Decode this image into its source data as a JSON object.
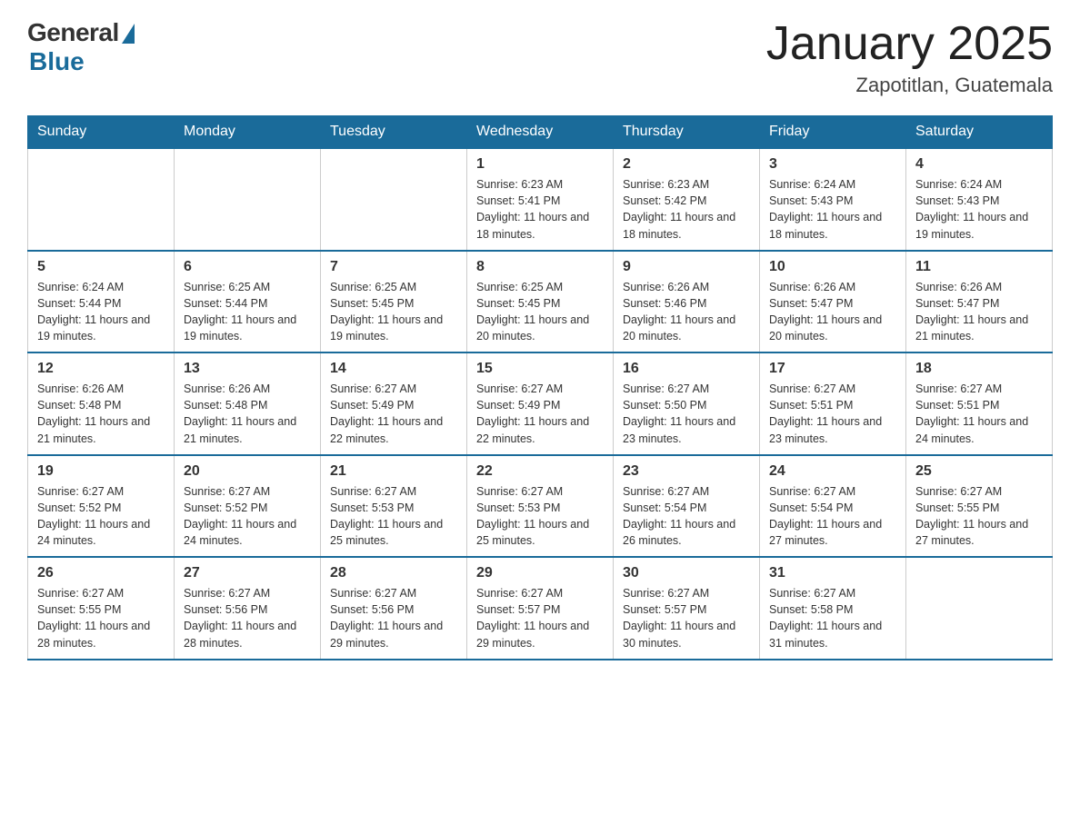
{
  "header": {
    "logo_general": "General",
    "logo_blue": "Blue",
    "month_title": "January 2025",
    "location": "Zapotitlan, Guatemala"
  },
  "weekdays": [
    "Sunday",
    "Monday",
    "Tuesday",
    "Wednesday",
    "Thursday",
    "Friday",
    "Saturday"
  ],
  "weeks": [
    [
      {
        "day": "",
        "info": ""
      },
      {
        "day": "",
        "info": ""
      },
      {
        "day": "",
        "info": ""
      },
      {
        "day": "1",
        "info": "Sunrise: 6:23 AM\nSunset: 5:41 PM\nDaylight: 11 hours\nand 18 minutes."
      },
      {
        "day": "2",
        "info": "Sunrise: 6:23 AM\nSunset: 5:42 PM\nDaylight: 11 hours\nand 18 minutes."
      },
      {
        "day": "3",
        "info": "Sunrise: 6:24 AM\nSunset: 5:43 PM\nDaylight: 11 hours\nand 18 minutes."
      },
      {
        "day": "4",
        "info": "Sunrise: 6:24 AM\nSunset: 5:43 PM\nDaylight: 11 hours\nand 19 minutes."
      }
    ],
    [
      {
        "day": "5",
        "info": "Sunrise: 6:24 AM\nSunset: 5:44 PM\nDaylight: 11 hours\nand 19 minutes."
      },
      {
        "day": "6",
        "info": "Sunrise: 6:25 AM\nSunset: 5:44 PM\nDaylight: 11 hours\nand 19 minutes."
      },
      {
        "day": "7",
        "info": "Sunrise: 6:25 AM\nSunset: 5:45 PM\nDaylight: 11 hours\nand 19 minutes."
      },
      {
        "day": "8",
        "info": "Sunrise: 6:25 AM\nSunset: 5:45 PM\nDaylight: 11 hours\nand 20 minutes."
      },
      {
        "day": "9",
        "info": "Sunrise: 6:26 AM\nSunset: 5:46 PM\nDaylight: 11 hours\nand 20 minutes."
      },
      {
        "day": "10",
        "info": "Sunrise: 6:26 AM\nSunset: 5:47 PM\nDaylight: 11 hours\nand 20 minutes."
      },
      {
        "day": "11",
        "info": "Sunrise: 6:26 AM\nSunset: 5:47 PM\nDaylight: 11 hours\nand 21 minutes."
      }
    ],
    [
      {
        "day": "12",
        "info": "Sunrise: 6:26 AM\nSunset: 5:48 PM\nDaylight: 11 hours\nand 21 minutes."
      },
      {
        "day": "13",
        "info": "Sunrise: 6:26 AM\nSunset: 5:48 PM\nDaylight: 11 hours\nand 21 minutes."
      },
      {
        "day": "14",
        "info": "Sunrise: 6:27 AM\nSunset: 5:49 PM\nDaylight: 11 hours\nand 22 minutes."
      },
      {
        "day": "15",
        "info": "Sunrise: 6:27 AM\nSunset: 5:49 PM\nDaylight: 11 hours\nand 22 minutes."
      },
      {
        "day": "16",
        "info": "Sunrise: 6:27 AM\nSunset: 5:50 PM\nDaylight: 11 hours\nand 23 minutes."
      },
      {
        "day": "17",
        "info": "Sunrise: 6:27 AM\nSunset: 5:51 PM\nDaylight: 11 hours\nand 23 minutes."
      },
      {
        "day": "18",
        "info": "Sunrise: 6:27 AM\nSunset: 5:51 PM\nDaylight: 11 hours\nand 24 minutes."
      }
    ],
    [
      {
        "day": "19",
        "info": "Sunrise: 6:27 AM\nSunset: 5:52 PM\nDaylight: 11 hours\nand 24 minutes."
      },
      {
        "day": "20",
        "info": "Sunrise: 6:27 AM\nSunset: 5:52 PM\nDaylight: 11 hours\nand 24 minutes."
      },
      {
        "day": "21",
        "info": "Sunrise: 6:27 AM\nSunset: 5:53 PM\nDaylight: 11 hours\nand 25 minutes."
      },
      {
        "day": "22",
        "info": "Sunrise: 6:27 AM\nSunset: 5:53 PM\nDaylight: 11 hours\nand 25 minutes."
      },
      {
        "day": "23",
        "info": "Sunrise: 6:27 AM\nSunset: 5:54 PM\nDaylight: 11 hours\nand 26 minutes."
      },
      {
        "day": "24",
        "info": "Sunrise: 6:27 AM\nSunset: 5:54 PM\nDaylight: 11 hours\nand 27 minutes."
      },
      {
        "day": "25",
        "info": "Sunrise: 6:27 AM\nSunset: 5:55 PM\nDaylight: 11 hours\nand 27 minutes."
      }
    ],
    [
      {
        "day": "26",
        "info": "Sunrise: 6:27 AM\nSunset: 5:55 PM\nDaylight: 11 hours\nand 28 minutes."
      },
      {
        "day": "27",
        "info": "Sunrise: 6:27 AM\nSunset: 5:56 PM\nDaylight: 11 hours\nand 28 minutes."
      },
      {
        "day": "28",
        "info": "Sunrise: 6:27 AM\nSunset: 5:56 PM\nDaylight: 11 hours\nand 29 minutes."
      },
      {
        "day": "29",
        "info": "Sunrise: 6:27 AM\nSunset: 5:57 PM\nDaylight: 11 hours\nand 29 minutes."
      },
      {
        "day": "30",
        "info": "Sunrise: 6:27 AM\nSunset: 5:57 PM\nDaylight: 11 hours\nand 30 minutes."
      },
      {
        "day": "31",
        "info": "Sunrise: 6:27 AM\nSunset: 5:58 PM\nDaylight: 11 hours\nand 31 minutes."
      },
      {
        "day": "",
        "info": ""
      }
    ]
  ]
}
